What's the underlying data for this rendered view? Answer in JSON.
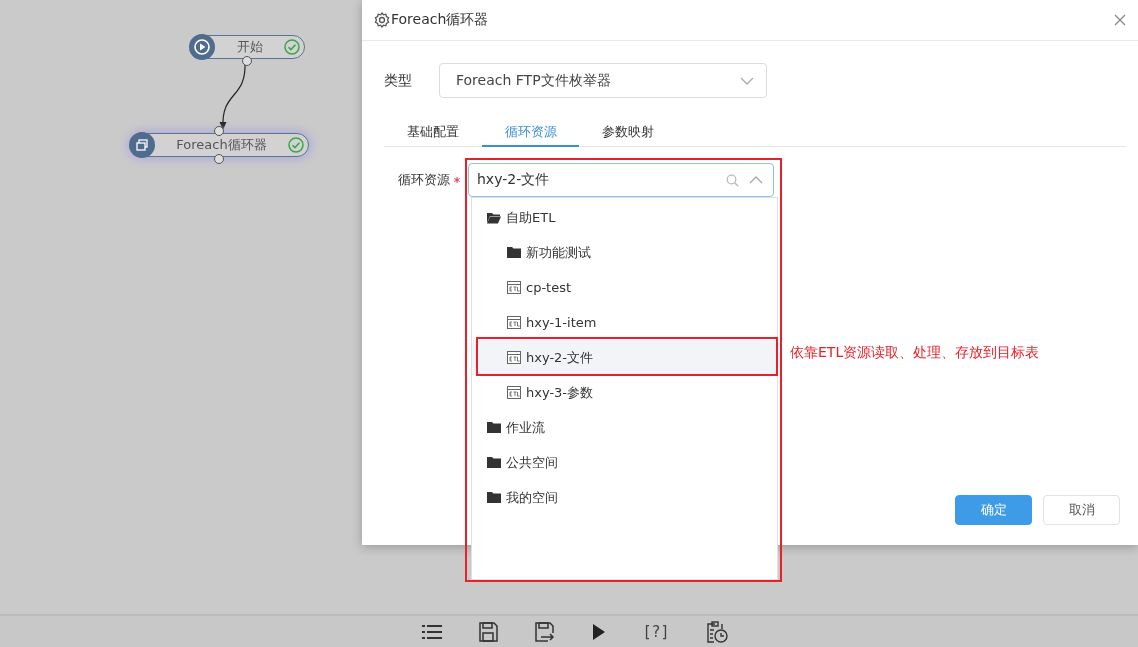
{
  "canvas": {
    "nodes": [
      {
        "kind": "start",
        "label": "开始",
        "valid": true,
        "selected": false
      },
      {
        "kind": "loop",
        "label": "Foreach循环器",
        "valid": true,
        "selected": true
      }
    ]
  },
  "dialog": {
    "title": "Foreach循环器",
    "type_field": {
      "label": "类型",
      "value": "Foreach FTP文件枚举器"
    },
    "tabs": [
      {
        "label": "基础配置",
        "selected": false
      },
      {
        "label": "循环资源",
        "selected": true
      },
      {
        "label": "参数映射",
        "selected": false
      }
    ],
    "resource_field": {
      "label": "循环资源",
      "required": true,
      "value": "hxy-2-文件",
      "expanded": true
    },
    "tree": [
      {
        "kind": "folder",
        "label": "自助ETL",
        "expanded": true,
        "selected": false,
        "children": [
          {
            "kind": "folder",
            "label": "新功能测试",
            "expanded": false,
            "selected": false
          },
          {
            "kind": "etl",
            "label": "cp-test",
            "selected": false
          },
          {
            "kind": "etl",
            "label": "hxy-1-item",
            "selected": false
          },
          {
            "kind": "etl",
            "label": "hxy-2-文件",
            "selected": true
          },
          {
            "kind": "etl",
            "label": "hxy-3-参数",
            "selected": false
          }
        ]
      },
      {
        "kind": "folder",
        "label": "作业流",
        "expanded": false,
        "selected": false
      },
      {
        "kind": "folder",
        "label": "公共空间",
        "expanded": false,
        "selected": false
      },
      {
        "kind": "folder",
        "label": "我的空间",
        "expanded": false,
        "selected": false
      }
    ],
    "buttons": [
      {
        "label": "确定",
        "primary": true
      },
      {
        "label": "取消",
        "primary": false
      }
    ]
  },
  "annotation": {
    "text": "依靠ETL资源读取、处理、存放到目标表"
  },
  "toolbar": {
    "items": [
      {
        "kind": "list"
      },
      {
        "kind": "save"
      },
      {
        "kind": "save-as"
      },
      {
        "kind": "run"
      },
      {
        "kind": "help",
        "text": "[?]"
      },
      {
        "kind": "schedule"
      }
    ]
  }
}
